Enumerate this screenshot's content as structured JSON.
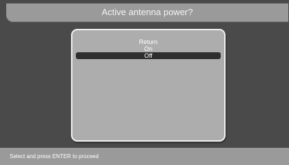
{
  "header": {
    "title": "Active antenna power?"
  },
  "dialog": {
    "items": [
      {
        "label": "Return",
        "selected": false
      },
      {
        "label": "On",
        "selected": false
      },
      {
        "label": "Off",
        "selected": true
      }
    ]
  },
  "status_bar": {
    "hint": "Select and press ENTER to proceed"
  },
  "colors": {
    "screen_background": "#4a4a4a",
    "bar_background": "#9a9a9a",
    "dialog_background": "#adadad",
    "selection_highlight": "#2e2e2e",
    "text": "#ffffff"
  }
}
